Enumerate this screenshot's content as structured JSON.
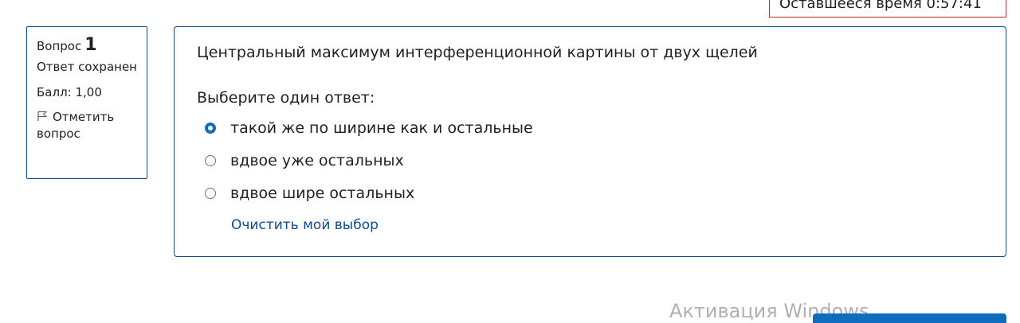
{
  "timer": {
    "text": "Оставшееся время 0:57:41"
  },
  "question_info": {
    "label": "Вопрос",
    "number": "1",
    "state": "Ответ сохранен",
    "grade": "Балл: 1,00",
    "flag_label": "Отметить вопрос",
    "flag_icon": "flag-icon"
  },
  "question": {
    "text": "Центральный максимум интерференционной картины от двух щелей",
    "prompt": "Выберите один ответ:",
    "answers": [
      {
        "label": "такой же по ширине как и остальные",
        "checked": true
      },
      {
        "label": "вдвое уже остальных",
        "checked": false
      },
      {
        "label": "вдвое шире остальных",
        "checked": false
      }
    ],
    "clear_label": "Очистить мой выбор"
  },
  "overlay": {
    "watermark": "Активация Windows"
  },
  "colors": {
    "accent": "#0f6cbf",
    "border": "#0f4a8a",
    "timer_border": "#c1272d"
  }
}
